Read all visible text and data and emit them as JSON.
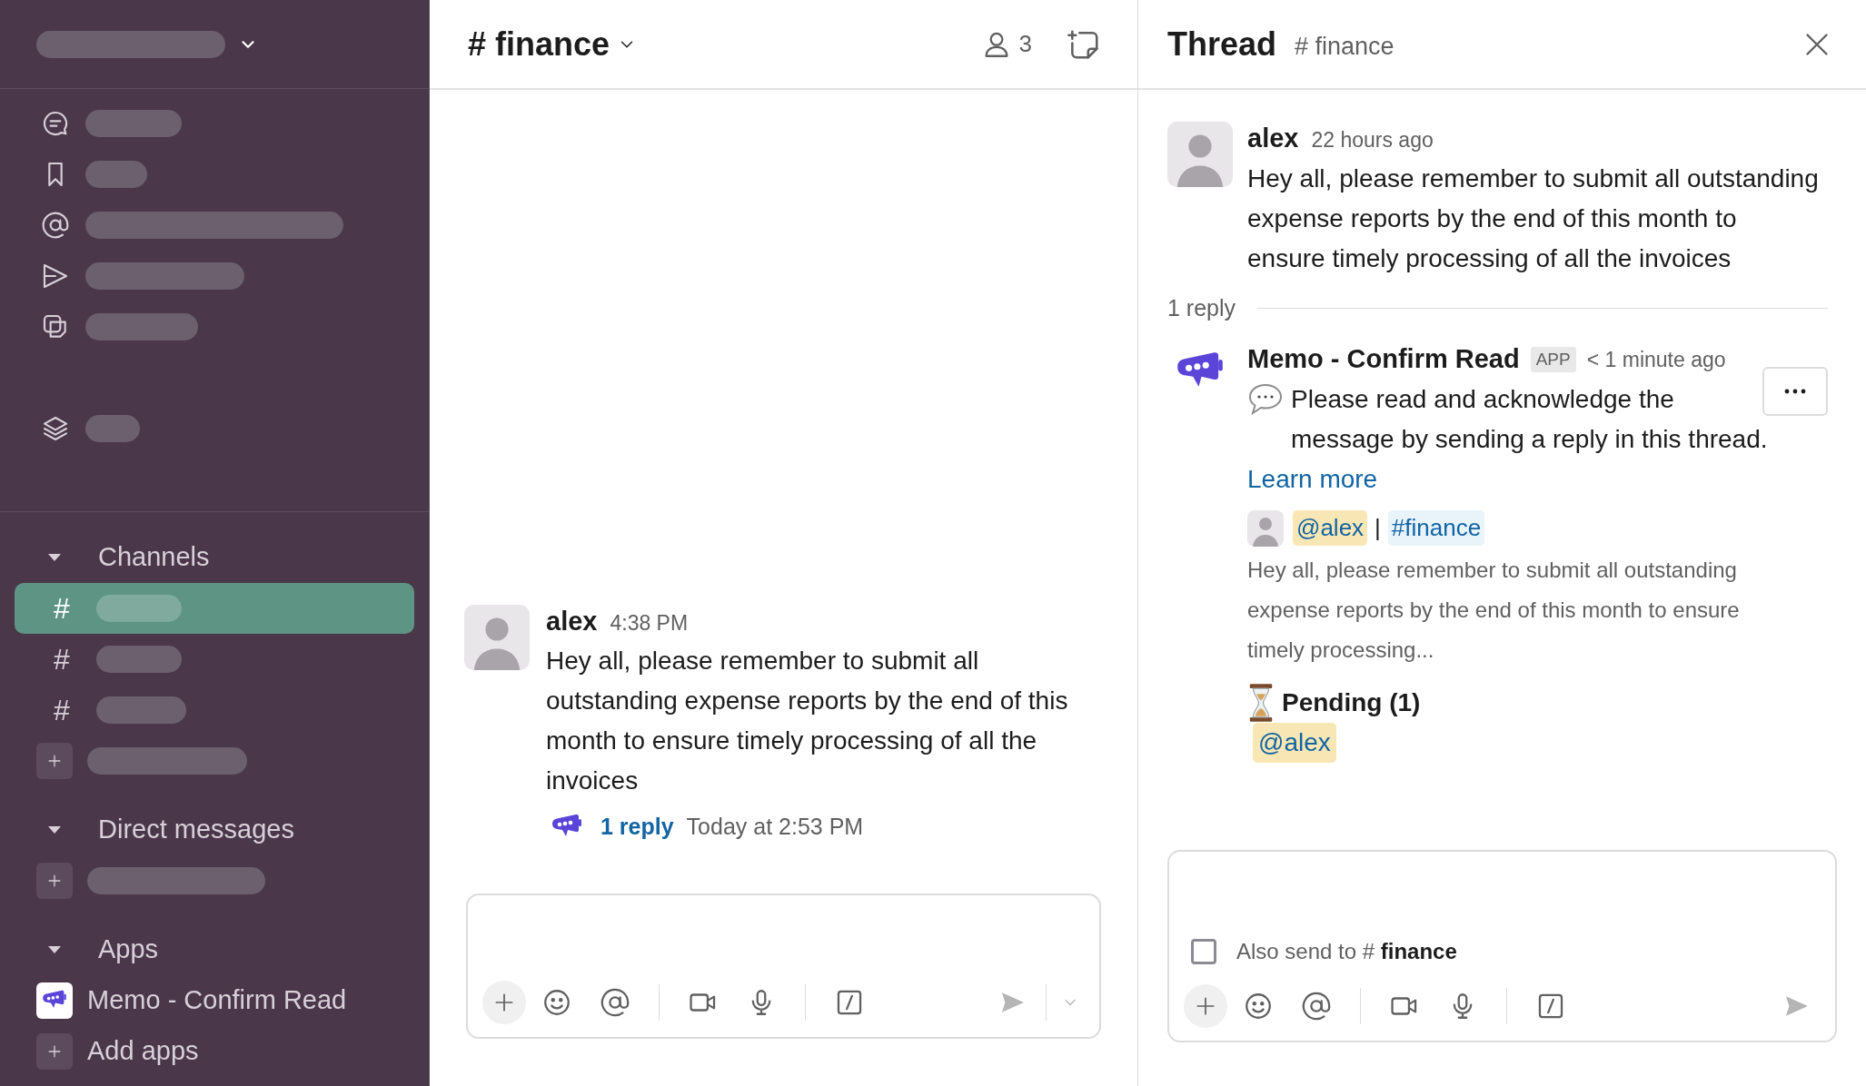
{
  "sidebar": {
    "nav_items": [
      {
        "kind": "threads"
      },
      {
        "kind": "saved"
      },
      {
        "kind": "mentions"
      },
      {
        "kind": "sent"
      },
      {
        "kind": "drafts"
      },
      {
        "kind": "more"
      }
    ],
    "sections": [
      {
        "title": "Channels",
        "expanded": true,
        "items": [
          {
            "kind": "channel",
            "prefix": "#",
            "selected": true
          },
          {
            "kind": "channel",
            "prefix": "#",
            "selected": false
          },
          {
            "kind": "channel",
            "prefix": "#",
            "selected": false
          },
          {
            "kind": "add",
            "selected": false
          }
        ]
      },
      {
        "title": "Direct messages",
        "expanded": true,
        "items": [
          {
            "kind": "add",
            "selected": false
          }
        ]
      },
      {
        "title": "Apps",
        "expanded": true,
        "items": [
          {
            "kind": "app",
            "label": "Memo - Confirm Read",
            "selected": false
          },
          {
            "kind": "add",
            "label": "Add apps",
            "selected": false
          }
        ]
      }
    ]
  },
  "channel": {
    "title": "# finance",
    "member_count": "3",
    "messages": [
      {
        "author": "alex",
        "time": "4:38 PM",
        "text": "Hey all, please remember to submit all outstanding expense reports by the end of this month to ensure timely processing of all the invoices",
        "thread": {
          "replies": "1 reply",
          "last_reply": "Today at 2:53 PM"
        }
      }
    ]
  },
  "thread": {
    "title": "Thread",
    "channel": "# finance",
    "parent": {
      "author": "alex",
      "time": "22 hours ago",
      "text": "Hey all, please remember to submit all outstanding expense reports by the end of this month to ensure timely processing of all the invoices"
    },
    "reply_count": "1 reply",
    "replies": [
      {
        "author": "Memo - Confirm Read",
        "badge": "APP",
        "time": "< 1 minute ago",
        "text": "Please read and acknowledge the message by sending a reply in this thread.",
        "link": "Learn more",
        "quote": {
          "mention": "@alex",
          "separator": "|",
          "channel": "#finance",
          "text": "Hey all, please remember to submit all outstanding expense reports by the end of this month to ensure timely processing..."
        },
        "pending": {
          "title": "Pending (1)",
          "mentions": [
            "@alex"
          ]
        }
      }
    ],
    "composer": {
      "also_send": "Also send to # **finance**",
      "checked": false
    }
  }
}
